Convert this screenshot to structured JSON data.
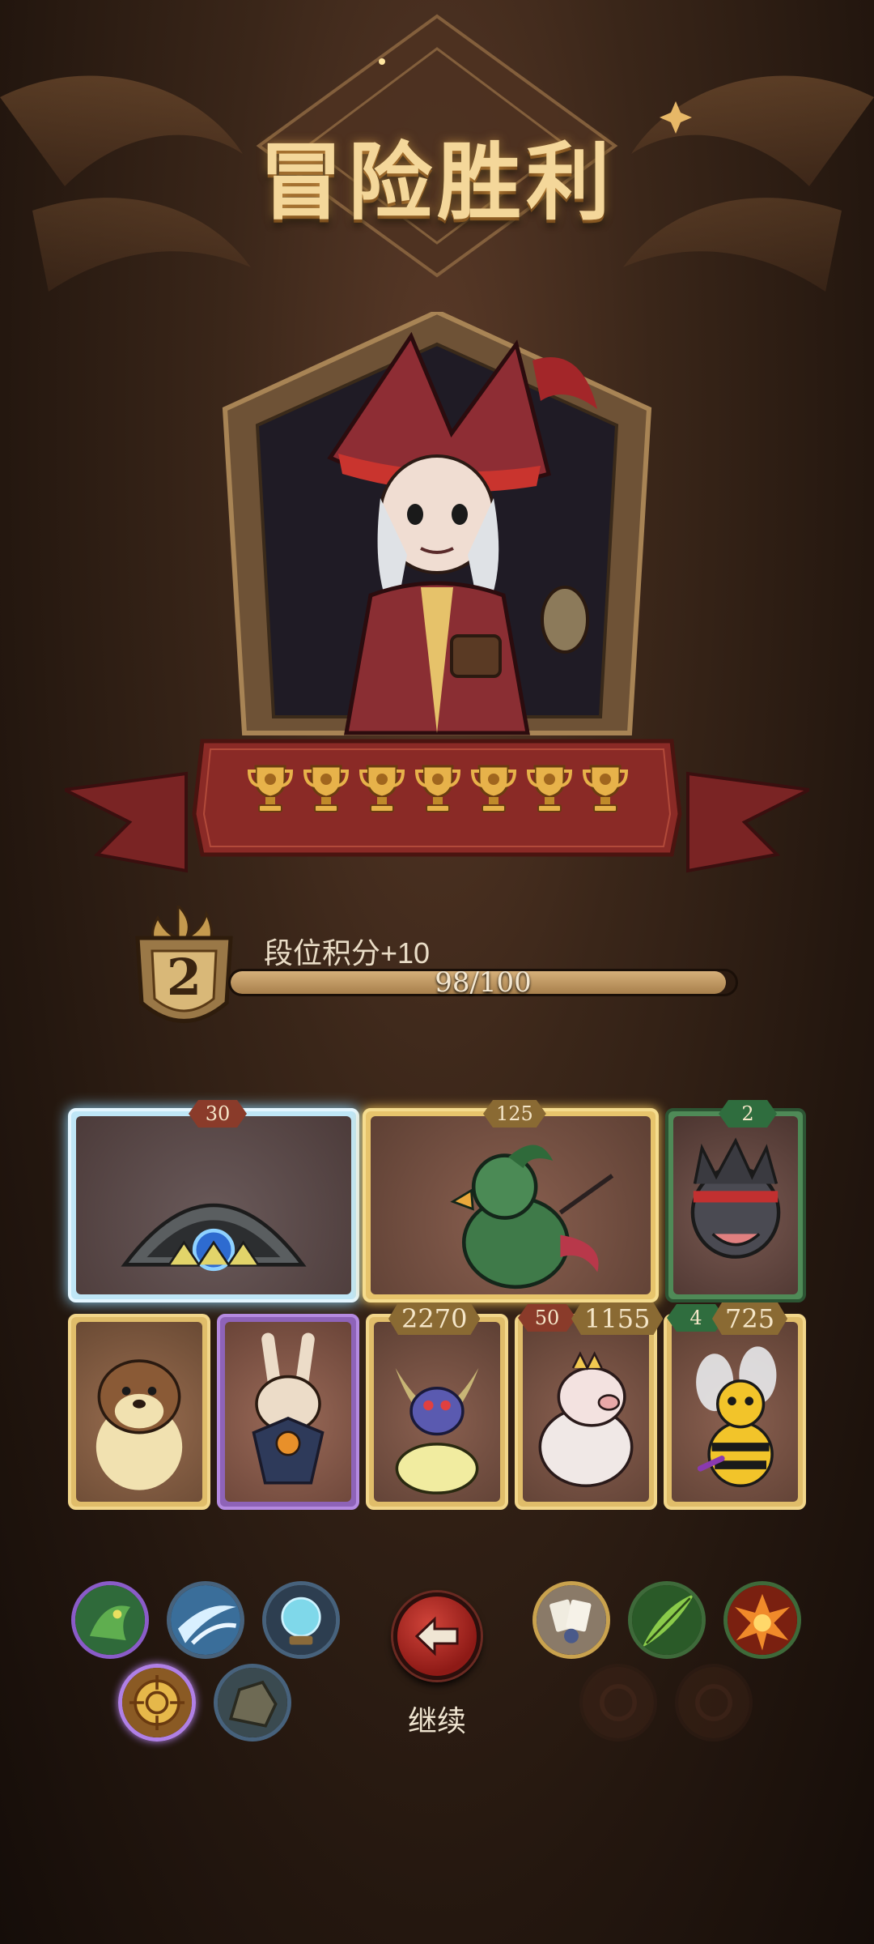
{
  "header": {
    "title": "冒险胜利"
  },
  "banner": {
    "trophy_count": 7,
    "trophy_icon": "trophy-icon"
  },
  "rank": {
    "level": "2",
    "points_label": "段位积分+10",
    "progress_text": "98/100",
    "progress": 0.98
  },
  "cards": {
    "row1": [
      {
        "name": "ice-shell-monster",
        "tag": "30",
        "tag_color": "red"
      },
      {
        "name": "green-parrot-bird",
        "tag": "125",
        "tag_color": "gold"
      },
      {
        "name": "spiky-bandana-creature",
        "tag": "2",
        "tag_color": "green"
      }
    ],
    "row2": [
      {
        "name": "otter"
      },
      {
        "name": "scarecrow-rabbit"
      },
      {
        "name": "bug-on-orb",
        "tag": "2270"
      },
      {
        "name": "pig-chef",
        "tag_small": "50",
        "tag": "1155"
      },
      {
        "name": "bee",
        "tag_small": "4",
        "tag": "725"
      }
    ]
  },
  "left_skills": [
    "green-dragon-icon",
    "ice-slash-icon",
    "crystal-ball-icon",
    "target-icon",
    "rock-icon"
  ],
  "right_skills": [
    "cards-icon",
    "leaf-blade-icon",
    "fire-burst-icon",
    "locked-slot-icon",
    "locked-slot-icon"
  ],
  "continue": {
    "label": "继续",
    "icon": "arrow-left-icon"
  },
  "colors": {
    "accent_gold": "#f4d79a",
    "banner_red": "#8a2a26",
    "button_red": "#c0362e"
  }
}
